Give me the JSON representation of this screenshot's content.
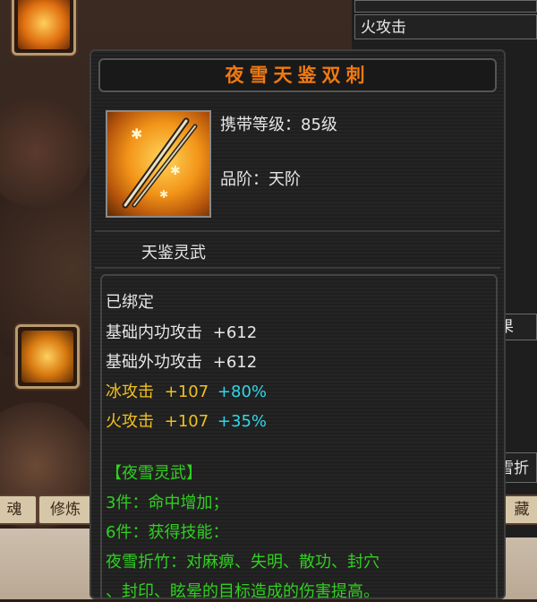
{
  "background": {
    "right_panel_rows": [
      "火攻击",
      "",
      "",
      "",
      "",
      "",
      "",
      "",
      "",
      "",
      "",
      "",
      "雪折",
      "藏"
    ],
    "side_tabs": [
      "魂",
      "修炼"
    ],
    "partial_right_label": "果"
  },
  "tooltip": {
    "item_name": "夜雪天鉴双刺",
    "carry_level": "携带等级：85级",
    "grade": "品阶：天阶",
    "category": "天鉴灵武",
    "bound": "已绑定",
    "stats": [
      {
        "label": "基础内功攻击",
        "value": "+612",
        "bonus": ""
      },
      {
        "label": "基础外功攻击",
        "value": "+612",
        "bonus": ""
      },
      {
        "label": "冰攻击",
        "value": "+107",
        "bonus": "+80%"
      },
      {
        "label": "火攻击",
        "value": "+107",
        "bonus": "+35%"
      }
    ],
    "set_name": "【夜雪灵武】",
    "set_effects": [
      "3件：命中增加；",
      "6件：获得技能：",
      "夜雪折竹：对麻痹、失明、散功、封穴",
      "、封印、眩晕的目标造成的伤害提高。"
    ]
  },
  "colors": {
    "title": "#f07a10",
    "stat_white": "#e6e6e6",
    "stat_yellow": "#f0c020",
    "bonus_cyan": "#30d8e8",
    "set_green": "#30d020"
  },
  "icons": {
    "item": "twin-daggers-icon",
    "equip_slot_top": "weapon-slot-icon",
    "equip_slot_bottom": "bracelet-slot-icon"
  }
}
